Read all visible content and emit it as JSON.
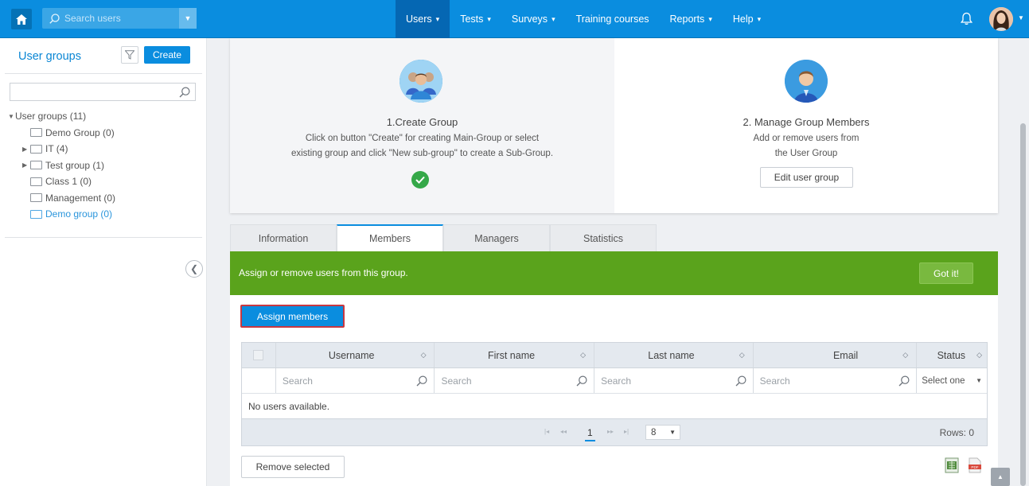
{
  "topbar": {
    "search_placeholder": "Search users",
    "nav": [
      {
        "label": "Users",
        "has_dropdown": true,
        "active": true
      },
      {
        "label": "Tests",
        "has_dropdown": true
      },
      {
        "label": "Surveys",
        "has_dropdown": true
      },
      {
        "label": "Training courses",
        "has_dropdown": false
      },
      {
        "label": "Reports",
        "has_dropdown": true
      },
      {
        "label": "Help",
        "has_dropdown": true
      }
    ],
    "accent": "#0a8ddf"
  },
  "sidebar": {
    "title": "User groups",
    "create_label": "Create",
    "search_value": "",
    "tree": [
      {
        "label": "User groups (11)",
        "level": 0,
        "toggle": "expanded",
        "folder": false
      },
      {
        "label": "Demo Group (0)",
        "level": 1,
        "toggle": "none",
        "folder": true
      },
      {
        "label": "IT (4)",
        "level": 1,
        "toggle": "collapsed",
        "folder": true
      },
      {
        "label": "Test group (1)",
        "level": 1,
        "toggle": "collapsed",
        "folder": true
      },
      {
        "label": "Class 1 (0)",
        "level": 1,
        "toggle": "none",
        "folder": true
      },
      {
        "label": "Management (0)",
        "level": 1,
        "toggle": "none",
        "folder": true
      },
      {
        "label": "Demo group (0)",
        "level": 1,
        "toggle": "none",
        "folder": true,
        "selected": true
      }
    ]
  },
  "steps": {
    "step1": {
      "title": "1.Create Group",
      "line1": "Click on button \"Create\" for creating Main-Group or select",
      "line2": "existing group and click \"New sub-group\" to create a Sub-Group."
    },
    "step2": {
      "title": "2. Manage Group Members",
      "line1": "Add or remove users from",
      "line2": "the User Group",
      "button": "Edit user group"
    }
  },
  "tabs": [
    {
      "label": "Information"
    },
    {
      "label": "Members",
      "active": true
    },
    {
      "label": "Managers"
    },
    {
      "label": "Statistics"
    }
  ],
  "banner": {
    "text": "Assign or remove users from this group.",
    "button": "Got it!",
    "color": "#5aa31c"
  },
  "assign_label": "Assign members",
  "grid": {
    "columns": [
      "Username",
      "First name",
      "Last name",
      "Email",
      "Status"
    ],
    "filter_placeholders": [
      "Search",
      "Search",
      "Search",
      "Search"
    ],
    "status_filter": "Select one",
    "empty_text": "No users available.",
    "page": "1",
    "page_size": "8",
    "rows_text": "Rows: 0"
  },
  "remove_label": "Remove selected"
}
